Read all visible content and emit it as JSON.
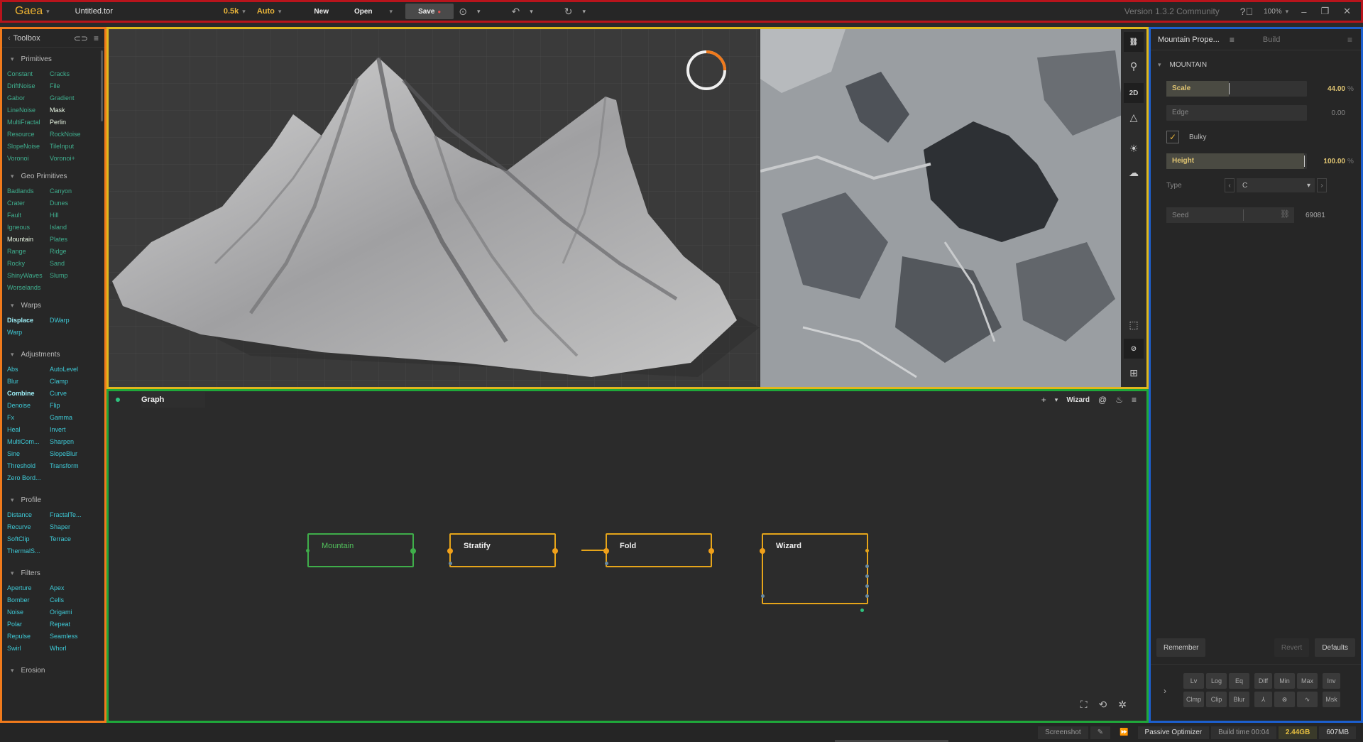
{
  "topbar": {
    "app_name": "Gaea",
    "file_name": "Untitled.tor",
    "resolution": "0.5k",
    "mode": "Auto",
    "new_label": "New",
    "open_label": "Open",
    "save_label": "Save",
    "version": "Version 1.3.2 Community",
    "zoom": "100%"
  },
  "toolbox": {
    "title": "Toolbox",
    "sections": [
      {
        "title": "Primitives",
        "items": [
          "Constant",
          "Cracks",
          "DriftNoise",
          "File",
          "Gabor",
          "Gradient",
          "LineNoise",
          "Mask",
          "MultiFractal",
          "Perlin",
          "Resource",
          "RockNoise",
          "SlopeNoise",
          "TileInput",
          "Voronoi",
          "Voronoi+"
        ]
      },
      {
        "title": "Geo Primitives",
        "items": [
          "Badlands",
          "Canyon",
          "Crater",
          "Dunes",
          "Fault",
          "Hill",
          "Igneous",
          "Island",
          "Mountain",
          "Plates",
          "Range",
          "Ridge",
          "Rocky",
          "Sand",
          "ShinyWaves",
          "Slump",
          "Worselands"
        ]
      },
      {
        "title": "Warps",
        "items": [
          "Displace",
          "DWarp",
          "Warp"
        ]
      },
      {
        "title": "Adjustments",
        "items": [
          "Abs",
          "AutoLevel",
          "Blur",
          "Clamp",
          "Combine",
          "Curve",
          "Denoise",
          "Flip",
          "Fx",
          "Gamma",
          "Heal",
          "Invert",
          "MultiCom...",
          "Sharpen",
          "Sine",
          "SlopeBlur",
          "Threshold",
          "Transform",
          "Zero Bord..."
        ]
      },
      {
        "title": "Profile",
        "items": [
          "Distance",
          "FractalTe...",
          "Recurve",
          "Shaper",
          "SoftClip",
          "Terrace",
          "ThermalS..."
        ]
      },
      {
        "title": "Filters",
        "items": [
          "Aperture",
          "Apex",
          "Bomber",
          "Cells",
          "Noise",
          "Origami",
          "Polar",
          "Repeat",
          "Repulse",
          "Seamless",
          "Swirl",
          "Whorl"
        ]
      },
      {
        "title": "Erosion",
        "items": []
      }
    ]
  },
  "viewport": {
    "mode_2d": "2D"
  },
  "graph": {
    "title": "Graph",
    "wizard_label": "Wizard",
    "nodes": [
      "Mountain",
      "Stratify",
      "Fold",
      "Wizard"
    ]
  },
  "properties": {
    "tab_title": "Mountain Prope...",
    "build_tab": "Build",
    "section": "MOUNTAIN",
    "scale": {
      "label": "Scale",
      "value": "44.00",
      "unit": "%"
    },
    "edge": {
      "label": "Edge",
      "value": "0.00"
    },
    "bulky": {
      "label": "Bulky",
      "checked": true
    },
    "height": {
      "label": "Height",
      "value": "100.00",
      "unit": "%"
    },
    "type": {
      "label": "Type",
      "value": "C"
    },
    "seed": {
      "label": "Seed",
      "value": "69081"
    },
    "remember": "Remember",
    "revert": "Revert",
    "defaults": "Defaults",
    "ops_row1": [
      "Lv",
      "Log",
      "Eq",
      "Diff",
      "Min",
      "Max",
      "Inv"
    ],
    "ops_row2": [
      "Clmp",
      "Clip",
      "Blur",
      "⅄",
      "⊗",
      "∿",
      "Msk"
    ]
  },
  "status": {
    "screenshot": "Screenshot",
    "optimizer": "Passive Optimizer",
    "build_time": "Build time 00:04",
    "memory": "2.44GB",
    "vram": "607MB"
  },
  "colors": {
    "accent": "#e8b43a",
    "node_green": "#3fae4a",
    "node_orange": "#e6a51a"
  }
}
